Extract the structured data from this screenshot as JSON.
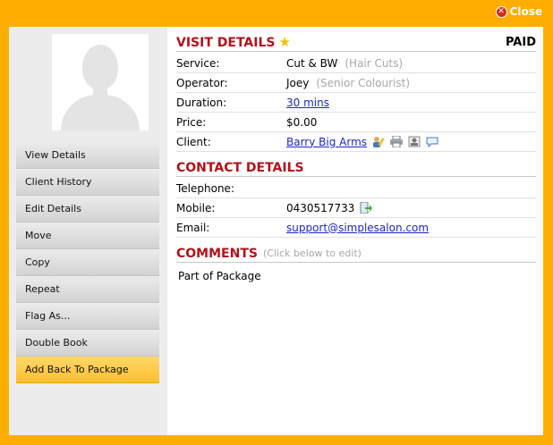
{
  "close_label": "Close",
  "sidebar": {
    "menu": [
      {
        "label": "View Details"
      },
      {
        "label": "Client History"
      },
      {
        "label": "Edit Details"
      },
      {
        "label": "Move"
      },
      {
        "label": "Copy"
      },
      {
        "label": "Repeat"
      },
      {
        "label": "Flag As..."
      },
      {
        "label": "Double Book"
      },
      {
        "label": "Add Back To Package"
      }
    ]
  },
  "visit": {
    "title": "VISIT DETAILS",
    "status": "PAID",
    "service_label": "Service:",
    "service_value": "Cut & BW",
    "service_category": "(Hair Cuts)",
    "operator_label": "Operator:",
    "operator_value": "Joey",
    "operator_role": "(Senior Colourist)",
    "duration_label": "Duration:",
    "duration_value": "30 mins",
    "price_label": "Price:",
    "price_value": "$0.00",
    "client_label": "Client:",
    "client_value": "Barry Big Arms"
  },
  "contact": {
    "title": "CONTACT DETAILS",
    "telephone_label": "Telephone:",
    "telephone_value": "",
    "mobile_label": "Mobile:",
    "mobile_value": "0430517733",
    "email_label": "Email:",
    "email_value": "support@simplesalon.com"
  },
  "comments": {
    "title": "COMMENTS",
    "hint": "(Click below to edit)",
    "text": "Part of Package"
  }
}
